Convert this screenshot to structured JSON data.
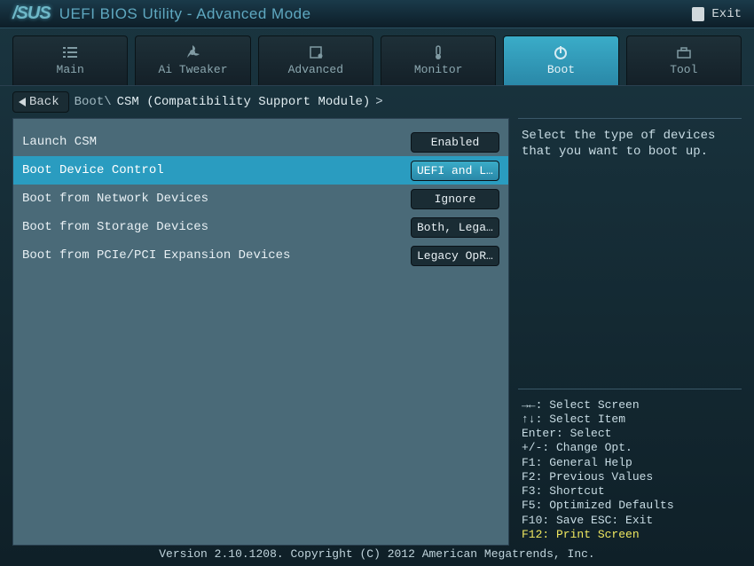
{
  "header": {
    "logo": "/SUS",
    "title": "UEFI BIOS Utility - Advanced Mode",
    "exit_label": "Exit"
  },
  "tabs": [
    {
      "label": "Main"
    },
    {
      "label": "Ai Tweaker"
    },
    {
      "label": "Advanced"
    },
    {
      "label": "Monitor"
    },
    {
      "label": "Boot"
    },
    {
      "label": "Tool"
    }
  ],
  "breadcrumb": {
    "back_label": "Back",
    "path": "Boot\\",
    "current": "CSM (Compatibility Support Module)",
    "chevron": ">"
  },
  "settings": [
    {
      "label": "Launch CSM",
      "value": "Enabled"
    },
    {
      "label": "Boot Device Control",
      "value": "UEFI and L..."
    },
    {
      "label": "Boot from Network Devices",
      "value": "Ignore"
    },
    {
      "label": "Boot from Storage Devices",
      "value": "Both, Lega..."
    },
    {
      "label": "Boot from PCIe/PCI Expansion Devices",
      "value": "Legacy OpR..."
    }
  ],
  "help_text": "Select the type of devices that you want to boot up.",
  "hints": [
    "→←: Select Screen",
    "↑↓: Select Item",
    "Enter: Select",
    "+/-: Change Opt.",
    "F1: General Help",
    "F2: Previous Values",
    "F3: Shortcut",
    "F5: Optimized Defaults",
    "F10: Save  ESC: Exit"
  ],
  "hint_highlight": "F12: Print Screen",
  "footer": "Version 2.10.1208. Copyright (C) 2012 American Megatrends, Inc."
}
